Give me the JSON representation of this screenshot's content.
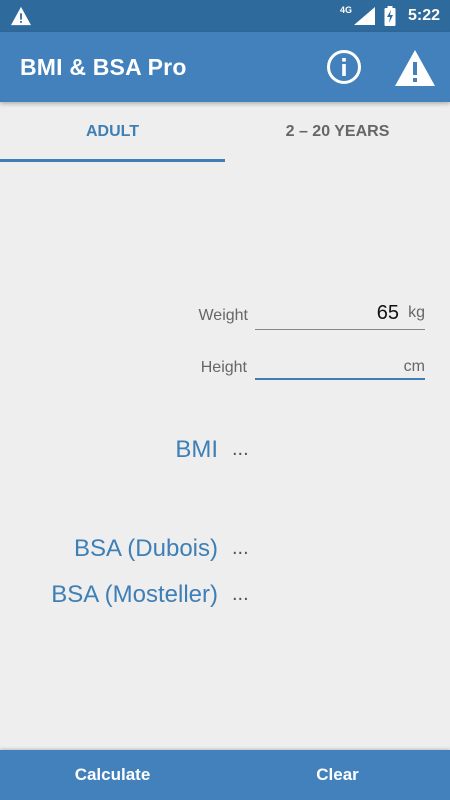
{
  "status_bar": {
    "network": "4G",
    "time": "5:22",
    "icons": [
      "warning-icon",
      "signal-icon",
      "battery-charging-icon"
    ]
  },
  "app_bar": {
    "title": "BMI & BSA Pro",
    "icons": [
      "info-icon",
      "warning-icon"
    ]
  },
  "tabs": [
    {
      "label": "ADULT",
      "selected": true
    },
    {
      "label": "2 – 20 YEARS",
      "selected": false
    }
  ],
  "form": {
    "weight": {
      "label": "Weight",
      "value": "65",
      "unit": "kg"
    },
    "height": {
      "label": "Height",
      "value": "",
      "unit": "cm"
    }
  },
  "results": {
    "bmi": {
      "label": "BMI",
      "value": "..."
    },
    "bsa_dubois": {
      "label": "BSA (Dubois)",
      "value": "..."
    },
    "bsa_mosteller": {
      "label": "BSA (Mosteller)",
      "value": "..."
    }
  },
  "actions": {
    "calculate": "Calculate",
    "clear": "Clear"
  },
  "colors": {
    "status_bar": "#2f6a9c",
    "primary": "#4281bb",
    "accent": "#3e7fb5",
    "background": "#eeeeee"
  }
}
